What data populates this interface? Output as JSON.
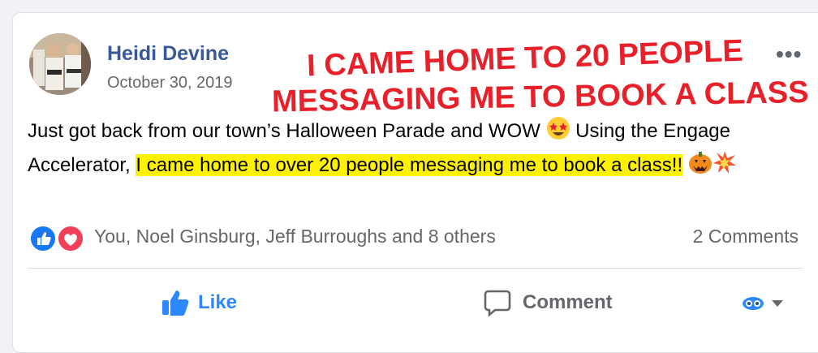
{
  "post": {
    "author": "Heidi Devine",
    "date": "October 30, 2019",
    "more_label": "•••",
    "text_plain": "Just got back from our town’s Halloween Parade and WOW ",
    "text_after_emoji": " Using the Engage Accelerator, ",
    "text_highlight": "I came home to over 20 people messaging me to book a class!!",
    "emoji_star": "star-struck",
    "emoji_pumpkin": "jack-o-lantern",
    "emoji_boom": "collision"
  },
  "overlay": {
    "line1": "I CAME HOME TO 20 PEOPLE",
    "line2": "MESSAGING ME TO BOOK A CLASS",
    "color": "#e8202a"
  },
  "reactions": {
    "types": [
      "like",
      "love"
    ],
    "names": "You, Noel Ginsburg, Jeff Burroughs and 8 others",
    "comments": "2 Comments"
  },
  "actions": {
    "like": "Like",
    "comment": "Comment"
  },
  "colors": {
    "link": "#385898",
    "like_blue": "#2d88ff",
    "highlight": "#fff200"
  }
}
